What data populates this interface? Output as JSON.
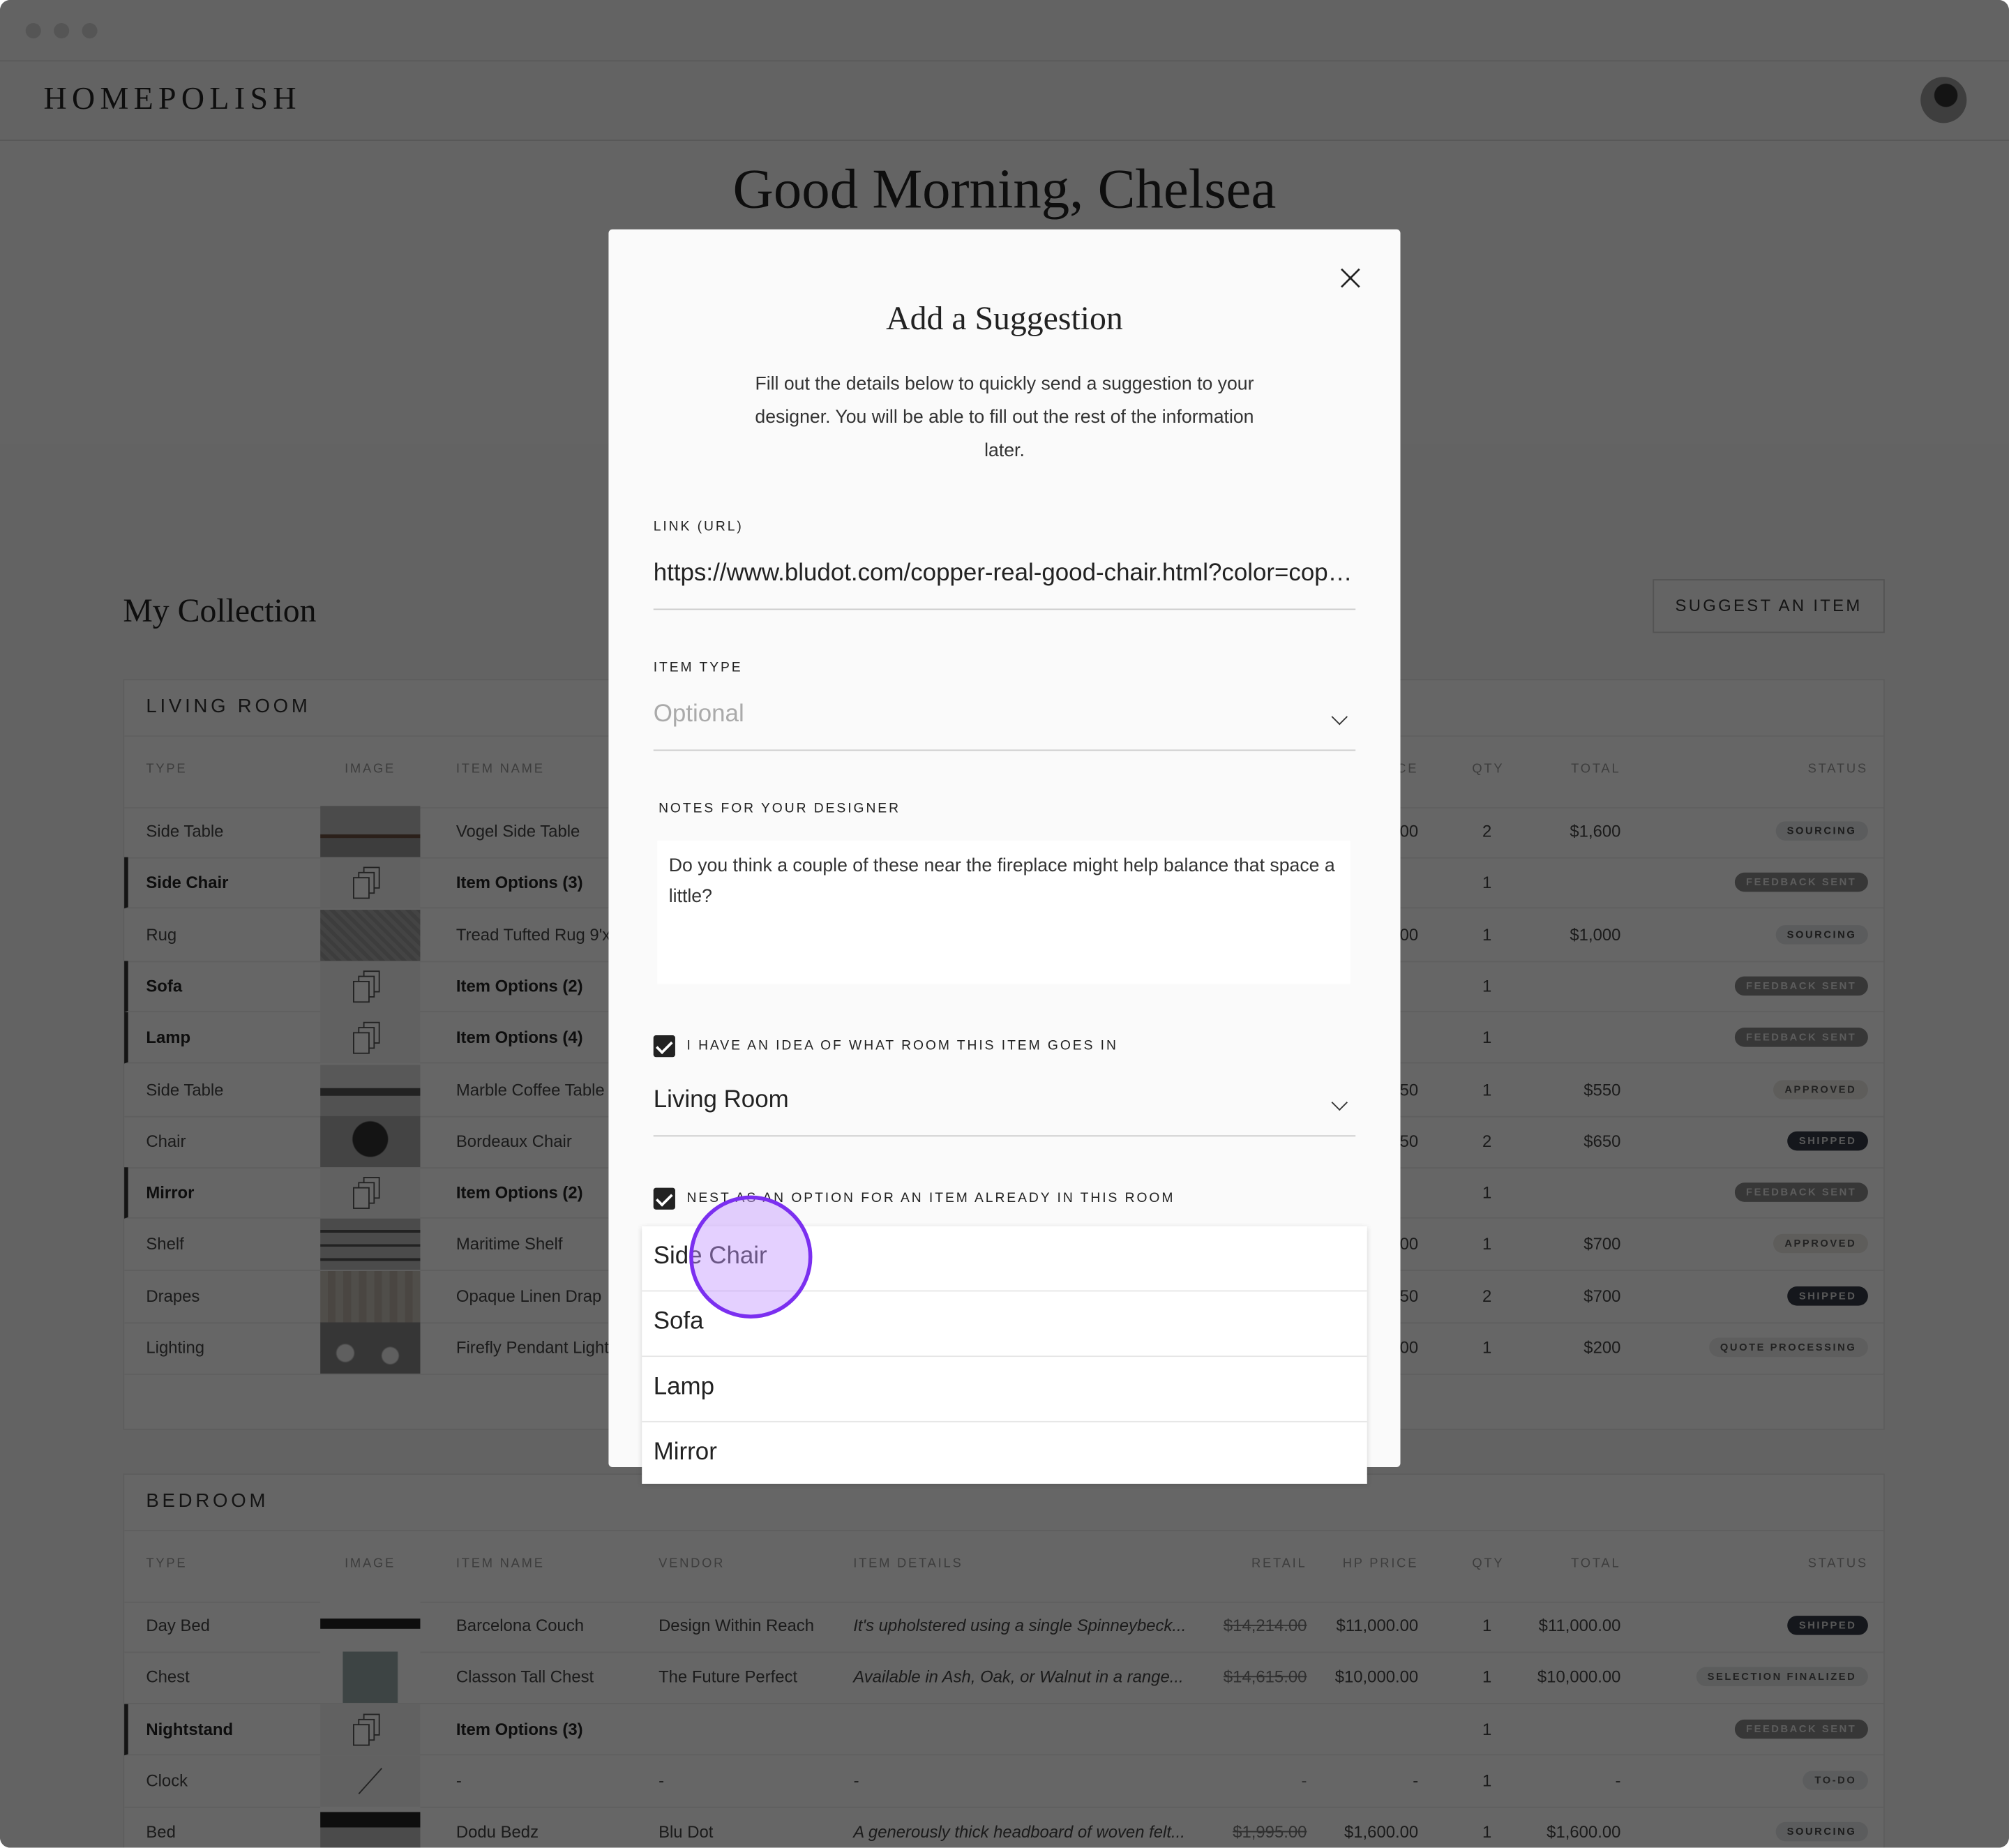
{
  "app": {
    "logo": "HOMEPOLISH",
    "greeting": "Good Morning, Chelsea"
  },
  "collection": {
    "title": "My Collection",
    "suggest_label": "SUGGEST AN ITEM"
  },
  "columns": [
    "TYPE",
    "IMAGE",
    "ITEM NAME",
    "VENDOR",
    "ITEM DETAILS",
    "RETAIL",
    "HP PRICE",
    "QTY",
    "TOTAL",
    "STATUS"
  ],
  "status_colors": {
    "SOURCING": [
      "#e4e6e8",
      "#444"
    ],
    "FEEDBACK SENT": [
      "#8a8a8a",
      "#e6e6e6"
    ],
    "APPROVED": [
      "#ece9e4",
      "#555"
    ],
    "SHIPPED": [
      "#343a46",
      "#ddd"
    ],
    "QUOTE PROCESSING": [
      "#ececea",
      "#555"
    ],
    "SELECTION FINALIZED": [
      "#e6e8e8",
      "#555"
    ],
    "TO-DO": [
      "#e6e8ea",
      "#555"
    ]
  },
  "rooms": [
    {
      "name": "LIVING ROOM",
      "rows": [
        {
          "type": "Side Table",
          "image": "wood",
          "name": "Vogel Side Table",
          "hp": "00",
          "qty": "2",
          "total": "$1,600",
          "status": "SOURCING"
        },
        {
          "type": "Side Chair",
          "image": "options",
          "name": "Item Options (3)",
          "qty": "1",
          "status": "FEEDBACK SENT",
          "option": true
        },
        {
          "type": "Rug",
          "image": "rug",
          "name": "Tread Tufted Rug 9'x",
          "hp": "00",
          "qty": "1",
          "total": "$1,000",
          "status": "SOURCING"
        },
        {
          "type": "Sofa",
          "image": "options",
          "name": "Item Options (2)",
          "qty": "1",
          "status": "FEEDBACK SENT",
          "option": true
        },
        {
          "type": "Lamp",
          "image": "options",
          "name": "Item Options (4)",
          "qty": "1",
          "status": "FEEDBACK SENT",
          "option": true
        },
        {
          "type": "Side Table",
          "image": "bench",
          "name": "Marble Coffee Table",
          "hp": "50",
          "qty": "1",
          "total": "$550",
          "status": "APPROVED"
        },
        {
          "type": "Chair",
          "image": "chair",
          "name": "Bordeaux Chair",
          "hp": "50",
          "qty": "2",
          "total": "$650",
          "status": "SHIPPED"
        },
        {
          "type": "Mirror",
          "image": "options",
          "name": "Item Options (2)",
          "qty": "1",
          "status": "FEEDBACK SENT",
          "option": true
        },
        {
          "type": "Shelf",
          "image": "shelf",
          "name": "Maritime Shelf",
          "hp": "00",
          "qty": "1",
          "total": "$700",
          "status": "APPROVED"
        },
        {
          "type": "Drapes",
          "image": "drapes",
          "name": "Opaque Linen Drap",
          "hp": "50",
          "qty": "2",
          "total": "$700",
          "status": "SHIPPED"
        },
        {
          "type": "Lighting",
          "image": "pendant",
          "name": "Firefly Pendant Light",
          "hp": "00",
          "qty": "1",
          "total": "$200",
          "status": "QUOTE PROCESSING"
        }
      ]
    },
    {
      "name": "BEDROOM",
      "rows": [
        {
          "type": "Day Bed",
          "image": "daybed",
          "name": "Barcelona Couch",
          "vendor": "Design Within Reach",
          "details": "It's upholstered using a single Spinneybeck...",
          "retail": "$14,214.00",
          "hp": "$11,000.00",
          "qty": "1",
          "total": "$11,000.00",
          "status": "SHIPPED"
        },
        {
          "type": "Chest",
          "image": "chest",
          "name": "Classon Tall Chest",
          "vendor": "The Future Perfect",
          "details": "Available in Ash, Oak, or Walnut in a range...",
          "retail": "$14,615.00",
          "hp": "$10,000.00",
          "qty": "1",
          "total": "$10,000.00",
          "status": "SELECTION FINALIZED"
        },
        {
          "type": "Nightstand",
          "image": "options",
          "name": "Item Options (3)",
          "qty": "1",
          "status": "FEEDBACK SENT",
          "option": true
        },
        {
          "type": "Clock",
          "image": "none",
          "name": "-",
          "vendor": "-",
          "details": "-",
          "retail": "-",
          "hp": "-",
          "qty": "1",
          "total": "-",
          "status": "TO-DO"
        },
        {
          "type": "Bed",
          "image": "bed",
          "name": "Dodu Bedz",
          "vendor": "Blu Dot",
          "details": "A generously thick headboard of woven felt...",
          "retail": "$1,995.00",
          "hp": "$1,600.00",
          "qty": "1",
          "total": "$1,600.00",
          "status": "SOURCING"
        }
      ]
    }
  ],
  "modal": {
    "title": "Add a Suggestion",
    "description": "Fill out the details below to quickly send a suggestion to your designer. You will be able to fill out the rest of the information later.",
    "link_label": "LINK (URL)",
    "link_value": "https://www.bludot.com/copper-real-good-chair.html?color=copper",
    "item_type_label": "ITEM TYPE",
    "item_type_placeholder": "Optional",
    "notes_label": "NOTES FOR YOUR DESIGNER",
    "notes_value": "Do you think a couple of these near the fireplace might help balance that space a little?",
    "room_checkbox_label": "I HAVE AN IDEA OF WHAT ROOM THIS ITEM GOES IN",
    "room_checked": true,
    "room_value": "Living Room",
    "nest_checkbox_label": "NEST AS AN OPTION FOR AN ITEM ALREADY IN THIS ROOM",
    "nest_checked": true,
    "nest_options": [
      "Side Chair",
      "Sofa",
      "Lamp",
      "Mirror"
    ],
    "accent": "#7b2ff0"
  }
}
